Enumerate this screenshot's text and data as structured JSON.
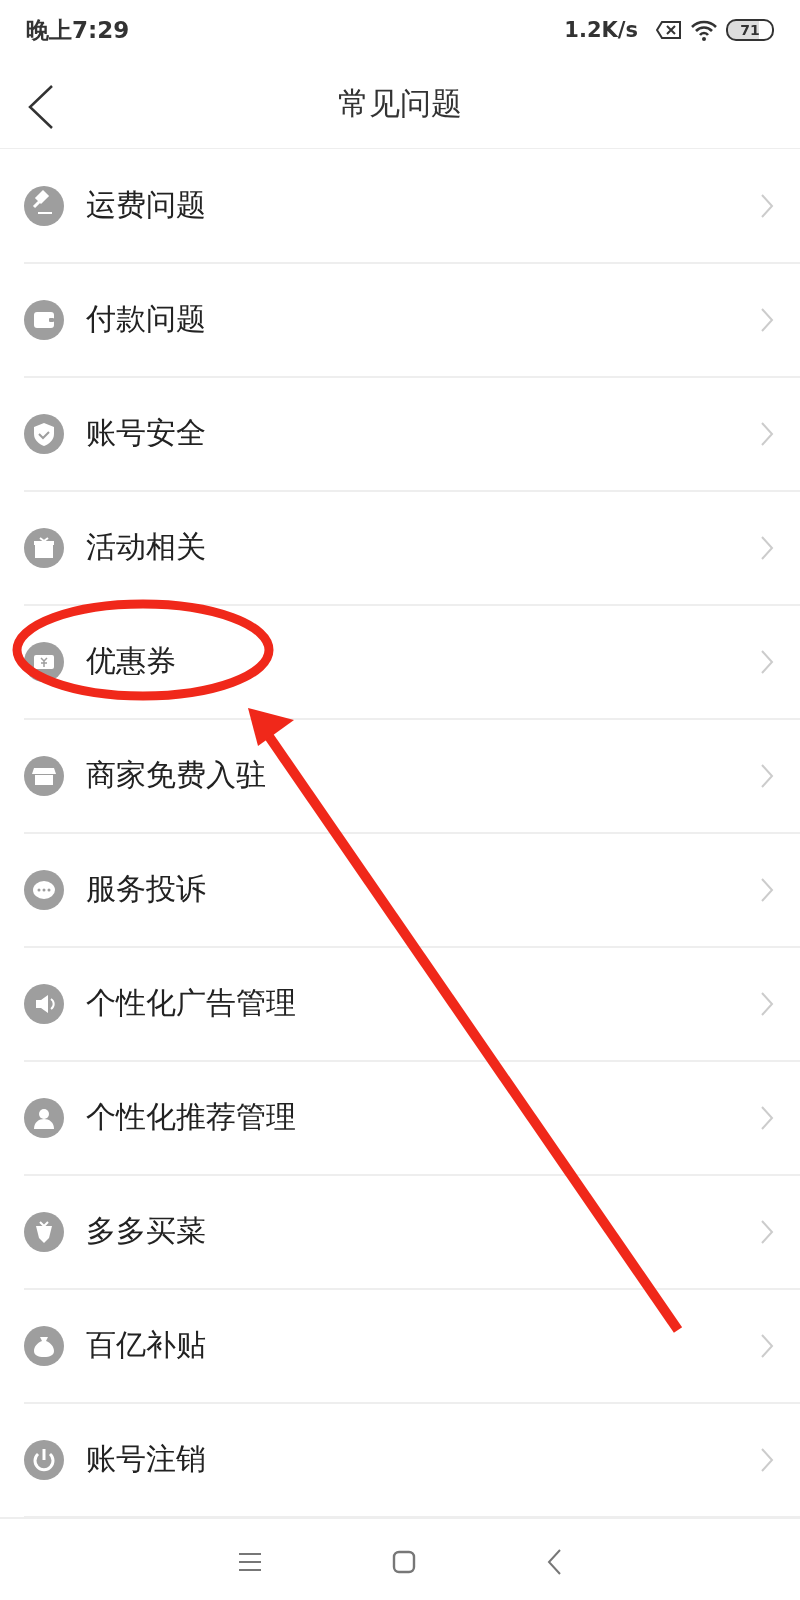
{
  "status_bar": {
    "time": "晚上7:29",
    "speed": "1.2K/s",
    "battery": "71"
  },
  "header": {
    "title": "常见问题"
  },
  "items": [
    {
      "label": "运费问题"
    },
    {
      "label": "付款问题"
    },
    {
      "label": "账号安全"
    },
    {
      "label": "活动相关"
    },
    {
      "label": "优惠券"
    },
    {
      "label": "商家免费入驻"
    },
    {
      "label": "服务投诉"
    },
    {
      "label": "个性化广告管理"
    },
    {
      "label": "个性化推荐管理"
    },
    {
      "label": "多多买菜"
    },
    {
      "label": "百亿补贴"
    },
    {
      "label": "账号注销"
    }
  ]
}
